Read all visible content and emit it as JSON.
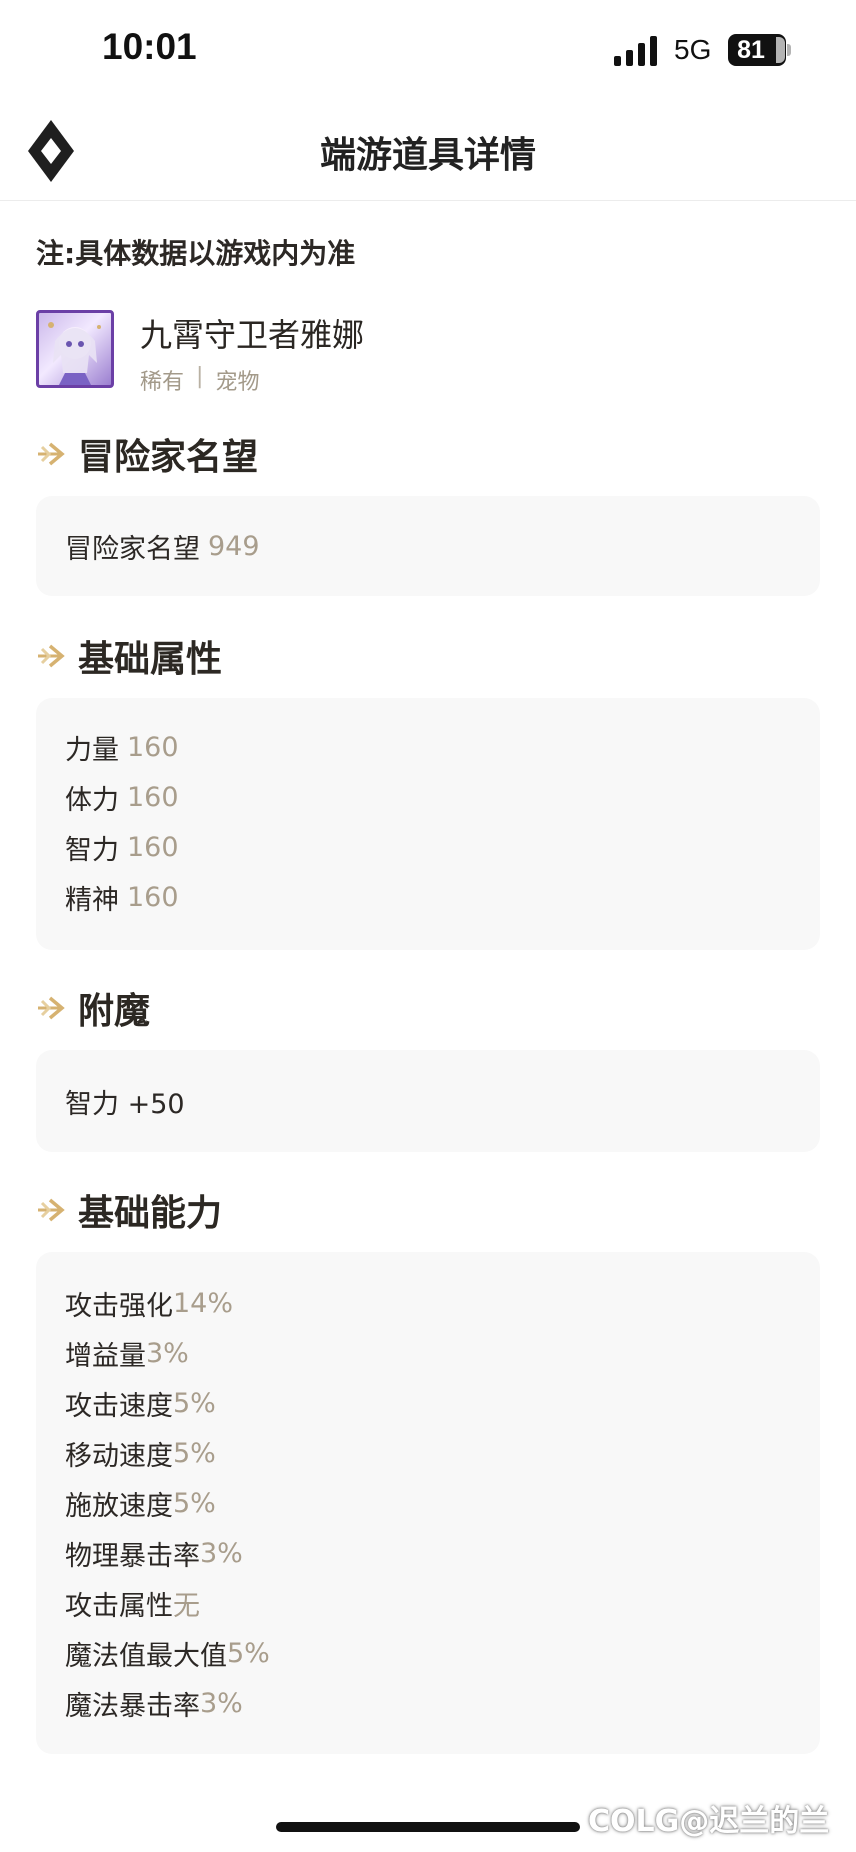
{
  "status_bar": {
    "time": "10:01",
    "network": "5G",
    "battery": "81"
  },
  "header": {
    "title": "端游道具详情",
    "logo_icon": "diamond-logo-icon"
  },
  "note": "注:具体数据以游戏内为准",
  "item": {
    "name": "九霄守卫者雅娜",
    "rarity": "稀有",
    "separator": "|",
    "category": "宠物",
    "rarity_color": "#a39a8a",
    "frame_color": "#6b3fa6"
  },
  "sections": {
    "reputation": {
      "title": "冒险家名望",
      "rows": [
        {
          "name": "冒险家名望",
          "value": "949"
        }
      ]
    },
    "base_attributes": {
      "title": "基础属性",
      "rows": [
        {
          "name": "力量",
          "value": "160"
        },
        {
          "name": "体力",
          "value": "160"
        },
        {
          "name": "智力",
          "value": "160"
        },
        {
          "name": "精神",
          "value": "160"
        }
      ]
    },
    "enchant": {
      "title": "附魔",
      "rows": [
        {
          "name": "智力 +50",
          "value": ""
        }
      ]
    },
    "base_abilities": {
      "title": "基础能力",
      "rows": [
        {
          "name": "攻击强化",
          "value": "14%"
        },
        {
          "name": "增益量",
          "value": "3%"
        },
        {
          "name": "攻击速度",
          "value": "5%"
        },
        {
          "name": "移动速度",
          "value": "5%"
        },
        {
          "name": "施放速度",
          "value": "5%"
        },
        {
          "name": "物理暴击率",
          "value": "3%"
        },
        {
          "name": "攻击属性",
          "value": "无"
        },
        {
          "name": "魔法值最大值",
          "value": "5%"
        },
        {
          "name": "魔法暴击率",
          "value": "3%"
        }
      ]
    }
  },
  "watermark": "COLG@迟兰的兰",
  "colors": {
    "accent": "#d6b271",
    "value_text": "#a89d8c",
    "card_bg": "#f8f8f8"
  }
}
